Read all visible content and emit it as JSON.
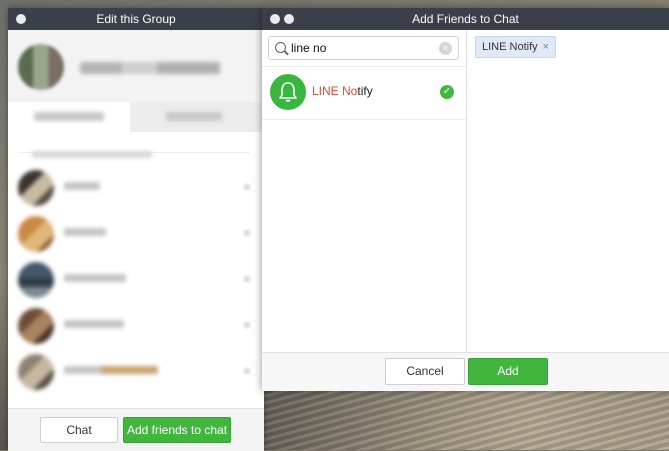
{
  "left_window": {
    "title": "Edit this Group",
    "buttons": {
      "chat_label": "Chat",
      "add_friends_label": "Add friends to chat"
    }
  },
  "right_window": {
    "title": "Add Friends to Chat",
    "search": {
      "value": "line no",
      "clear_icon": "×"
    },
    "results": [
      {
        "name_highlight": "LINE No",
        "name_rest": "tify",
        "selected": true
      }
    ],
    "selected_chips": [
      {
        "label": "LINE Notify",
        "remove_icon": "×"
      }
    ],
    "buttons": {
      "cancel_label": "Cancel",
      "add_label": "Add"
    }
  },
  "colors": {
    "accent_green": "#40b63d",
    "match_highlight": "#e8452c",
    "titlebar": "#3b3f4a"
  },
  "icons": [
    "search-icon",
    "clear-icon",
    "bell-icon",
    "check-icon",
    "close-icon"
  ]
}
